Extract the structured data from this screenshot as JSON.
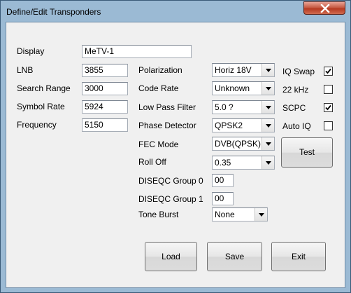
{
  "window": {
    "title": "Define/Edit Transponders"
  },
  "fields": {
    "display": {
      "label": "Display",
      "value": "MeTV-1"
    },
    "lnb": {
      "label": "LNB",
      "value": "3855"
    },
    "search_range": {
      "label": "Search Range",
      "value": "3000"
    },
    "symbol_rate": {
      "label": "Symbol Rate",
      "value": "5924"
    },
    "frequency": {
      "label": "Frequency",
      "value": "5150"
    }
  },
  "combos": {
    "polarization": {
      "label": "Polarization",
      "value": "Horiz 18V"
    },
    "code_rate": {
      "label": "Code Rate",
      "value": "Unknown"
    },
    "low_pass_filter": {
      "label": "Low Pass Filter",
      "value": "5.0 ?"
    },
    "phase_detector": {
      "label": "Phase Detector",
      "value": "QPSK2"
    },
    "fec_mode": {
      "label": "FEC Mode",
      "value": "DVB(QPSK)"
    },
    "roll_off": {
      "label": "Roll Off",
      "value": "0.35"
    },
    "tone_burst": {
      "label": "Tone Burst",
      "value": "None"
    }
  },
  "diseqc": {
    "group0": {
      "label": "DISEQC Group 0",
      "value": "00"
    },
    "group1": {
      "label": "DISEQC Group 1",
      "value": "00"
    }
  },
  "checkboxes": {
    "iq_swap": {
      "label": "IQ Swap",
      "checked": true
    },
    "khz22": {
      "label": "22 kHz",
      "checked": false
    },
    "scpc": {
      "label": "SCPC",
      "checked": true
    },
    "auto_iq": {
      "label": "Auto IQ",
      "checked": false
    }
  },
  "buttons": {
    "test": "Test",
    "load": "Load",
    "save": "Save",
    "exit": "Exit"
  },
  "icons": {
    "close": "close-icon",
    "check": "checkmark-icon",
    "dropdown": "chevron-down-icon"
  }
}
